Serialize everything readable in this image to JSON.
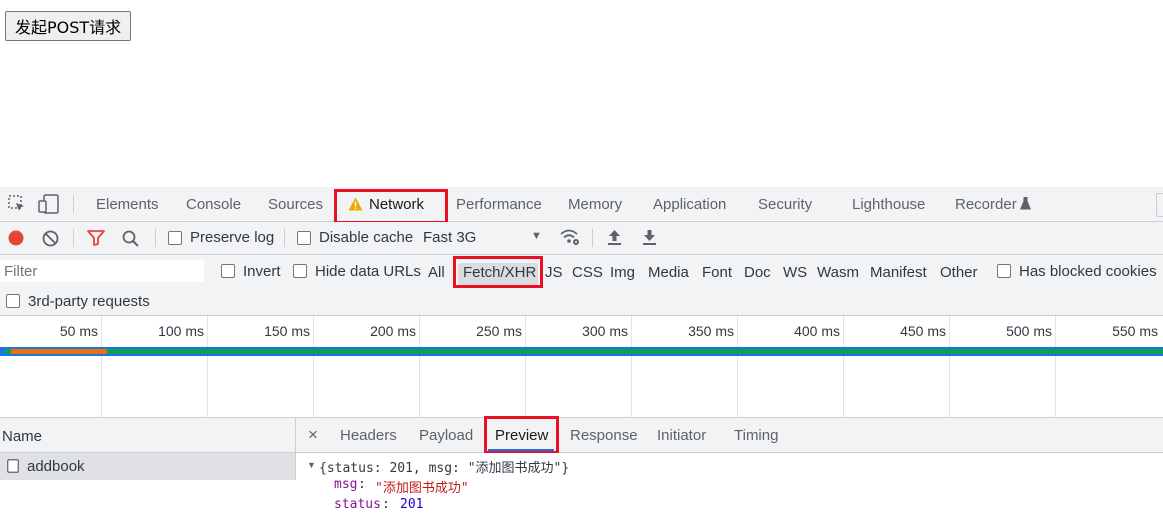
{
  "page": {
    "button_label": "发起POST请求"
  },
  "devtools": {
    "tabs": [
      {
        "label": "Elements"
      },
      {
        "label": "Console"
      },
      {
        "label": "Sources"
      },
      {
        "label": "Network"
      },
      {
        "label": "Performance"
      },
      {
        "label": "Memory"
      },
      {
        "label": "Application"
      },
      {
        "label": "Security"
      },
      {
        "label": "Lighthouse"
      },
      {
        "label": "Recorder"
      }
    ],
    "toolbar": {
      "preserve_log": "Preserve log",
      "disable_cache": "Disable cache",
      "throttle": "Fast 3G"
    },
    "filter": {
      "placeholder": "Filter",
      "invert": "Invert",
      "hide_data_urls": "Hide data URLs",
      "types": [
        "All",
        "Fetch/XHR",
        "JS",
        "CSS",
        "Img",
        "Media",
        "Font",
        "Doc",
        "WS",
        "Wasm",
        "Manifest",
        "Other"
      ],
      "has_blocked_cookies": "Has blocked cookies",
      "third_party": "3rd-party requests"
    },
    "timeline": {
      "ticks": [
        "50 ms",
        "100 ms",
        "150 ms",
        "200 ms",
        "250 ms",
        "300 ms",
        "350 ms",
        "400 ms",
        "450 ms",
        "500 ms",
        "550 ms"
      ]
    },
    "requests": {
      "header": "Name",
      "rows": [
        {
          "name": "addbook"
        }
      ]
    },
    "detail_tabs": [
      "Headers",
      "Payload",
      "Preview",
      "Response",
      "Initiator",
      "Timing"
    ],
    "preview": {
      "summary": "{status: 201, msg: \"添加图书成功\"}",
      "msg_key": "msg",
      "msg_value": "\"添加图书成功\"",
      "status_key": "status",
      "status_value": "201"
    },
    "colors": {
      "accent_red": "#e81224",
      "bar_green": "#0f9d58",
      "bar_blue": "#1a73e8",
      "bar_orange": "#e8710a"
    }
  }
}
